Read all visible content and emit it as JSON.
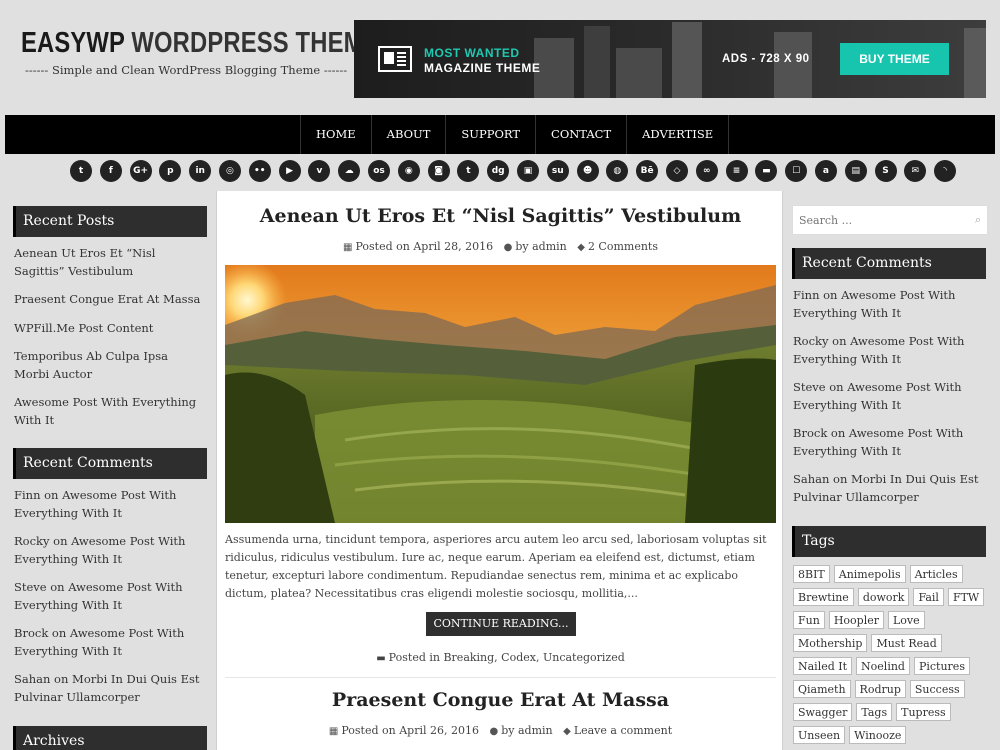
{
  "header": {
    "title_part1": "EASYWP",
    "title_part2": "WORDPRESS THEME",
    "tagline": "------ Simple and Clean WordPress Blogging Theme ------",
    "banner": {
      "line1": "MOST WANTED",
      "line2": "MAGAZINE THEME",
      "ads_label": "ADS - 728 X 90",
      "buy_label": "BUY THEME"
    }
  },
  "nav": {
    "items": [
      "HOME",
      "ABOUT",
      "SUPPORT",
      "CONTACT",
      "ADVERTISE"
    ]
  },
  "social": {
    "icons": [
      {
        "name": "twitter-icon",
        "glyph": "t"
      },
      {
        "name": "facebook-icon",
        "glyph": "f"
      },
      {
        "name": "google-plus-icon",
        "glyph": "G+"
      },
      {
        "name": "pinterest-icon",
        "glyph": "p"
      },
      {
        "name": "linkedin-icon",
        "glyph": "in"
      },
      {
        "name": "instagram-icon",
        "glyph": "◎"
      },
      {
        "name": "flickr-icon",
        "glyph": "••"
      },
      {
        "name": "youtube-icon",
        "glyph": "▶"
      },
      {
        "name": "vimeo-icon",
        "glyph": "v"
      },
      {
        "name": "soundcloud-icon",
        "glyph": "☁"
      },
      {
        "name": "lastfm-icon",
        "glyph": "os"
      },
      {
        "name": "github-icon",
        "glyph": "◉"
      },
      {
        "name": "foursquare-icon",
        "glyph": "◙"
      },
      {
        "name": "tumblr-icon",
        "glyph": "t"
      },
      {
        "name": "digg-icon",
        "glyph": "dg"
      },
      {
        "name": "delicious-icon",
        "glyph": "▣"
      },
      {
        "name": "stumbleupon-icon",
        "glyph": "su"
      },
      {
        "name": "reddit-icon",
        "glyph": "☻"
      },
      {
        "name": "dribbble-icon",
        "glyph": "◍"
      },
      {
        "name": "behance-icon",
        "glyph": "Bē"
      },
      {
        "name": "codepen-icon",
        "glyph": "◇"
      },
      {
        "name": "jsfiddle-icon",
        "glyph": "∞"
      },
      {
        "name": "stack-overflow-icon",
        "glyph": "≡"
      },
      {
        "name": "bars-icon",
        "glyph": "▬"
      },
      {
        "name": "android-icon",
        "glyph": "☐"
      },
      {
        "name": "amazon-icon",
        "glyph": "a"
      },
      {
        "name": "printer-icon",
        "glyph": "▤"
      },
      {
        "name": "skype-icon",
        "glyph": "S"
      },
      {
        "name": "email-icon",
        "glyph": "✉"
      },
      {
        "name": "rss-icon",
        "glyph": "◝"
      }
    ]
  },
  "left_sidebar": {
    "recent_posts_title": "Recent Posts",
    "recent_posts": [
      "Aenean Ut Eros Et “Nisl Sagittis” Vestibulum",
      "Praesent Congue Erat At Massa",
      "WPFill.Me Post Content",
      "Temporibus Ab Culpa Ipsa Morbi Auctor",
      "Awesome Post With Everything With It"
    ],
    "recent_comments_title": "Recent Comments",
    "recent_comments": [
      "Finn on Awesome Post With Everything With It",
      "Rocky on Awesome Post With Everything With It",
      "Steve on Awesome Post With Everything With It",
      "Brock on Awesome Post With Everything With It",
      "Sahan on Morbi In Dui Quis Est Pulvinar Ullamcorper"
    ],
    "archives_title": "Archives"
  },
  "main": {
    "post1": {
      "title": "Aenean Ut Eros Et “Nisl Sagittis” Vestibulum",
      "date": "Posted on April 28, 2016",
      "author": "by admin",
      "comments": "2 Comments",
      "excerpt": "Assumenda urna, tincidunt tempora, asperiores arcu autem leo arcu sed, laboriosam voluptas sit ridiculus, ridiculus vestibulum. Iure ac, neque earum. Aperiam ea eleifend est, dictumst, etiam tenetur, excepturi labore condimentum. Repudiandae senectus rem, minima et ac explicabo dictum, platea? Necessitatibus cras eligendi molestie sociosqu, mollitia,...",
      "continue_label": "CONTINUE READING...",
      "categories": "Posted in Breaking, Codex, Uncategorized"
    },
    "post2": {
      "title": "Praesent Congue Erat At Massa",
      "date": "Posted on April 26, 2016",
      "author": "by admin",
      "comments": "Leave a comment"
    }
  },
  "right_sidebar": {
    "search_placeholder": "Search ...",
    "recent_comments_title": "Recent Comments",
    "recent_comments": [
      "Finn on Awesome Post With Everything With It",
      "Rocky on Awesome Post With Everything With It",
      "Steve on Awesome Post With Everything With It",
      "Brock on Awesome Post With Everything With It",
      "Sahan on Morbi In Dui Quis Est Pulvinar Ullamcorper"
    ],
    "tags_title": "Tags",
    "tags": [
      "8BIT",
      "Animepolis",
      "Articles",
      "Brewtine",
      "dowork",
      "Fail",
      "FTW",
      "Fun",
      "Hoopler",
      "Love",
      "Mothership",
      "Must Read",
      "Nailed It",
      "Noelind",
      "Pictures",
      "Qiameth",
      "Rodrup",
      "Success",
      "Swagger",
      "Tags",
      "Tupress",
      "Unseen",
      "Winooze"
    ]
  }
}
